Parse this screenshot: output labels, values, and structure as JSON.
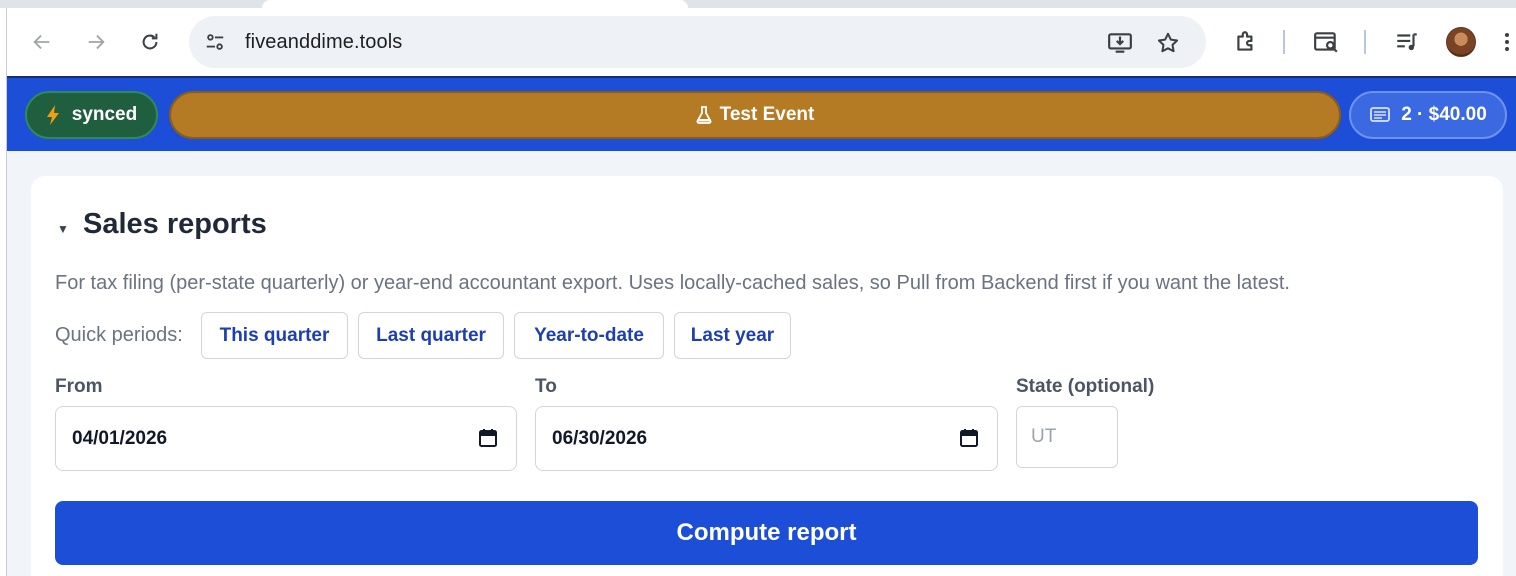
{
  "browser": {
    "url": "fiveanddime.tools"
  },
  "header": {
    "sync_label": "synced",
    "event_label": "Test Event",
    "cart_label": "2 · $40.00"
  },
  "section": {
    "title": "Sales reports",
    "description": "For tax filing (per-state quarterly) or year-end accountant export. Uses locally-cached sales, so Pull from Backend first if you want the latest.",
    "quick_periods_label": "Quick periods:",
    "quick_periods": [
      "This quarter",
      "Last quarter",
      "Year-to-date",
      "Last year"
    ]
  },
  "form": {
    "from_label": "From",
    "from_value": "04/01/2026",
    "to_label": "To",
    "to_value": "06/30/2026",
    "state_label": "State (optional)",
    "state_placeholder": "UT",
    "compute_label": "Compute report"
  },
  "colors": {
    "header_bg": "#1d4ed8",
    "synced_bg": "#1f5e3e",
    "event_bg": "#b47a24",
    "cart_bg": "#3b69e2",
    "link": "#1e40af"
  }
}
